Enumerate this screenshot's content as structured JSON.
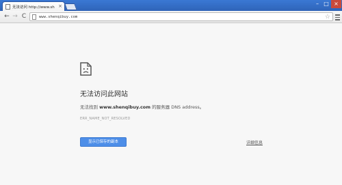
{
  "tab": {
    "title": "无法访问 http://www.sh",
    "close": "×"
  },
  "window": {
    "minimize": "–",
    "maximize": "□",
    "close": "×"
  },
  "toolbar": {
    "back": "←",
    "forward": "→",
    "reload": "C"
  },
  "address": {
    "url": "www.shenqibuy.com",
    "star": "☆"
  },
  "error": {
    "title": "无法访问此网站",
    "desc_prefix": "无法找到",
    "desc_domain": "www.shenqibuy.com",
    "desc_suffix": "的服务器 DNS address。",
    "code": "ERR_NAME_NOT_RESOLVED",
    "button": "显示已保存的副本",
    "details": "详细信息"
  }
}
